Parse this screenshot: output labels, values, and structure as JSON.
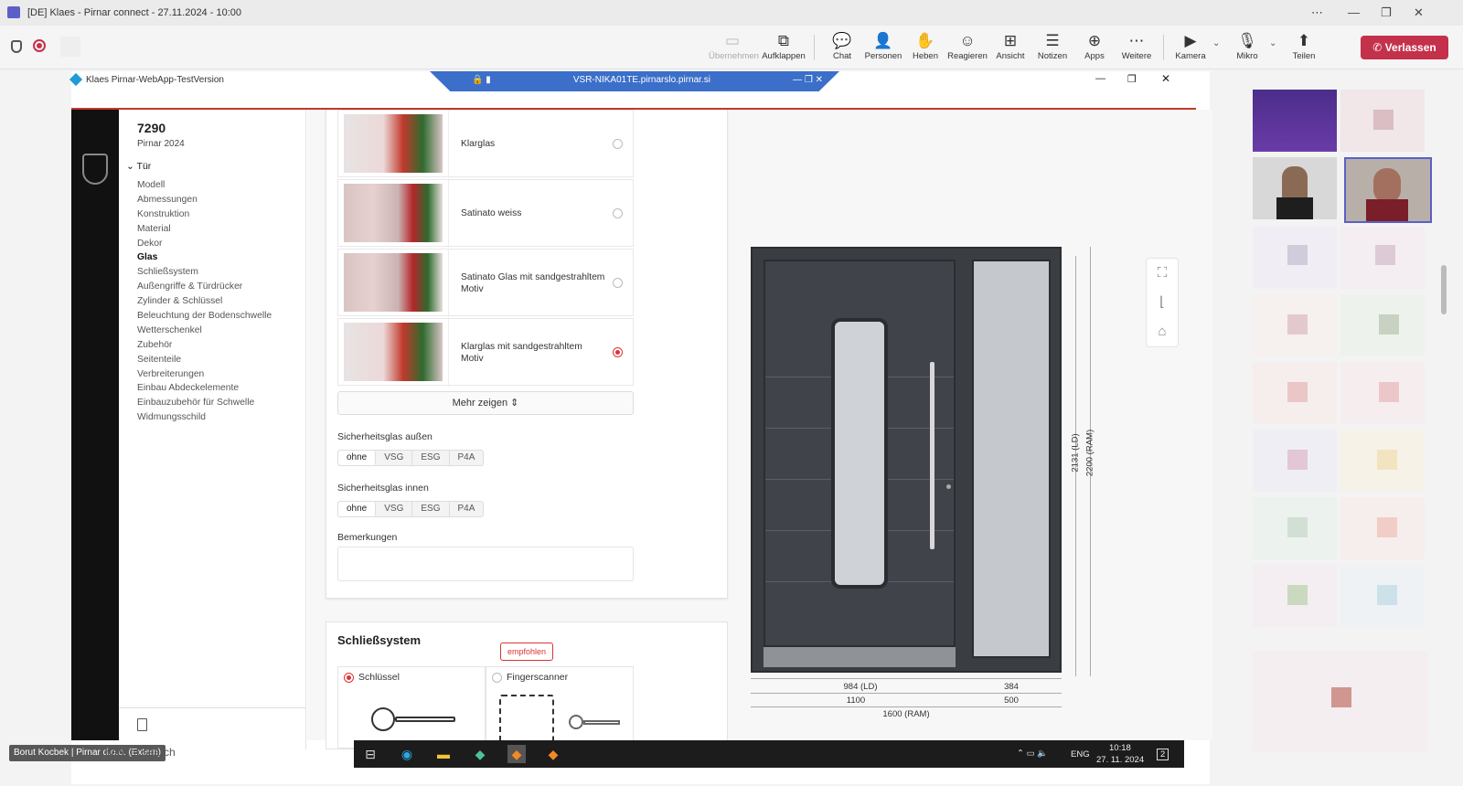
{
  "teams": {
    "window_title": "[DE] Klaes - Pirnar connect - 27.11.2024 - 10:00",
    "toolbar": [
      {
        "label": "Übernehmen",
        "icon": "take-control-icon",
        "disabled": true
      },
      {
        "label": "Aufklappen",
        "icon": "pop-out-icon"
      },
      {
        "label": "Chat",
        "icon": "chat-icon"
      },
      {
        "label": "Personen",
        "icon": "people-icon"
      },
      {
        "label": "Heben",
        "icon": "raise-hand-icon"
      },
      {
        "label": "Reagieren",
        "icon": "react-icon"
      },
      {
        "label": "Ansicht",
        "icon": "view-icon"
      },
      {
        "label": "Notizen",
        "icon": "notes-icon"
      },
      {
        "label": "Apps",
        "icon": "apps-icon"
      },
      {
        "label": "Weitere",
        "icon": "more-icon"
      },
      {
        "label": "Kamera",
        "icon": "camera-off-icon"
      },
      {
        "label": "Mikro",
        "icon": "mic-off-icon"
      },
      {
        "label": "Teilen",
        "icon": "share-icon"
      }
    ],
    "leave_label": "Verlassen",
    "presenter_name": "Borut Kocbek | Pirnar d.o.o. (Extern)"
  },
  "remote": {
    "app_title": "Klaes Pirnar-WebApp-TestVersion",
    "session_host": "VSR-NIKA01TE.pirnarslo.pirnar.si"
  },
  "sidebar": {
    "order_number": "7290",
    "subtitle": "Pirnar 2024",
    "section": "Tür",
    "items": [
      "Modell",
      "Abmessungen",
      "Konstruktion",
      "Material",
      "Dekor",
      "Glas",
      "Schließsystem",
      "Außengriffe & Türdrücker",
      "Zylinder & Schlüssel",
      "Beleuchtung der Bodenschwelle",
      "Wetterschenkel",
      "Zubehör",
      "Seitenteile",
      "Verbreiterungen",
      "Einbau Abdeckelemente",
      "Einbauzubehör für Schwelle",
      "Widmungsschild"
    ],
    "active_item": "Glas"
  },
  "glass": {
    "options": [
      {
        "label": "Klarglas",
        "selected": false
      },
      {
        "label": "Satinato weiss",
        "selected": false
      },
      {
        "label": "Satinato Glas mit sandgestrahltem Motiv",
        "selected": false
      },
      {
        "label": "Klarglas mit sandgestrahltem Motiv",
        "selected": true
      }
    ],
    "more_label": "Mehr zeigen",
    "outer_label": "Sicherheitsglas außen",
    "inner_label": "Sicherheitsglas innen",
    "safety_options": [
      "ohne",
      "VSG",
      "ESG",
      "P4A"
    ],
    "outer_selected": "ohne",
    "inner_selected": "ohne",
    "remarks_label": "Bemerkungen"
  },
  "lock": {
    "title": "Schließsystem",
    "recommended_badge": "empfohlen",
    "options": [
      {
        "label": "Schlüssel",
        "selected": true
      },
      {
        "label": "Fingerscanner",
        "selected": false
      }
    ]
  },
  "drawing": {
    "dim_leaf_width": "984 (LD)",
    "dim_side_width": "384",
    "dim_leaf_total": "1100",
    "dim_side_total": "500",
    "dim_total_width": "1600 (RAM)",
    "dim_leaf_height": "2131 (LD)",
    "dim_total_height": "2200 (RAM)"
  },
  "taskbar": {
    "search_placeholder": "here to search",
    "language": "ENG",
    "time": "10:18",
    "date": "27. 11. 2024",
    "notification_count": "2"
  }
}
